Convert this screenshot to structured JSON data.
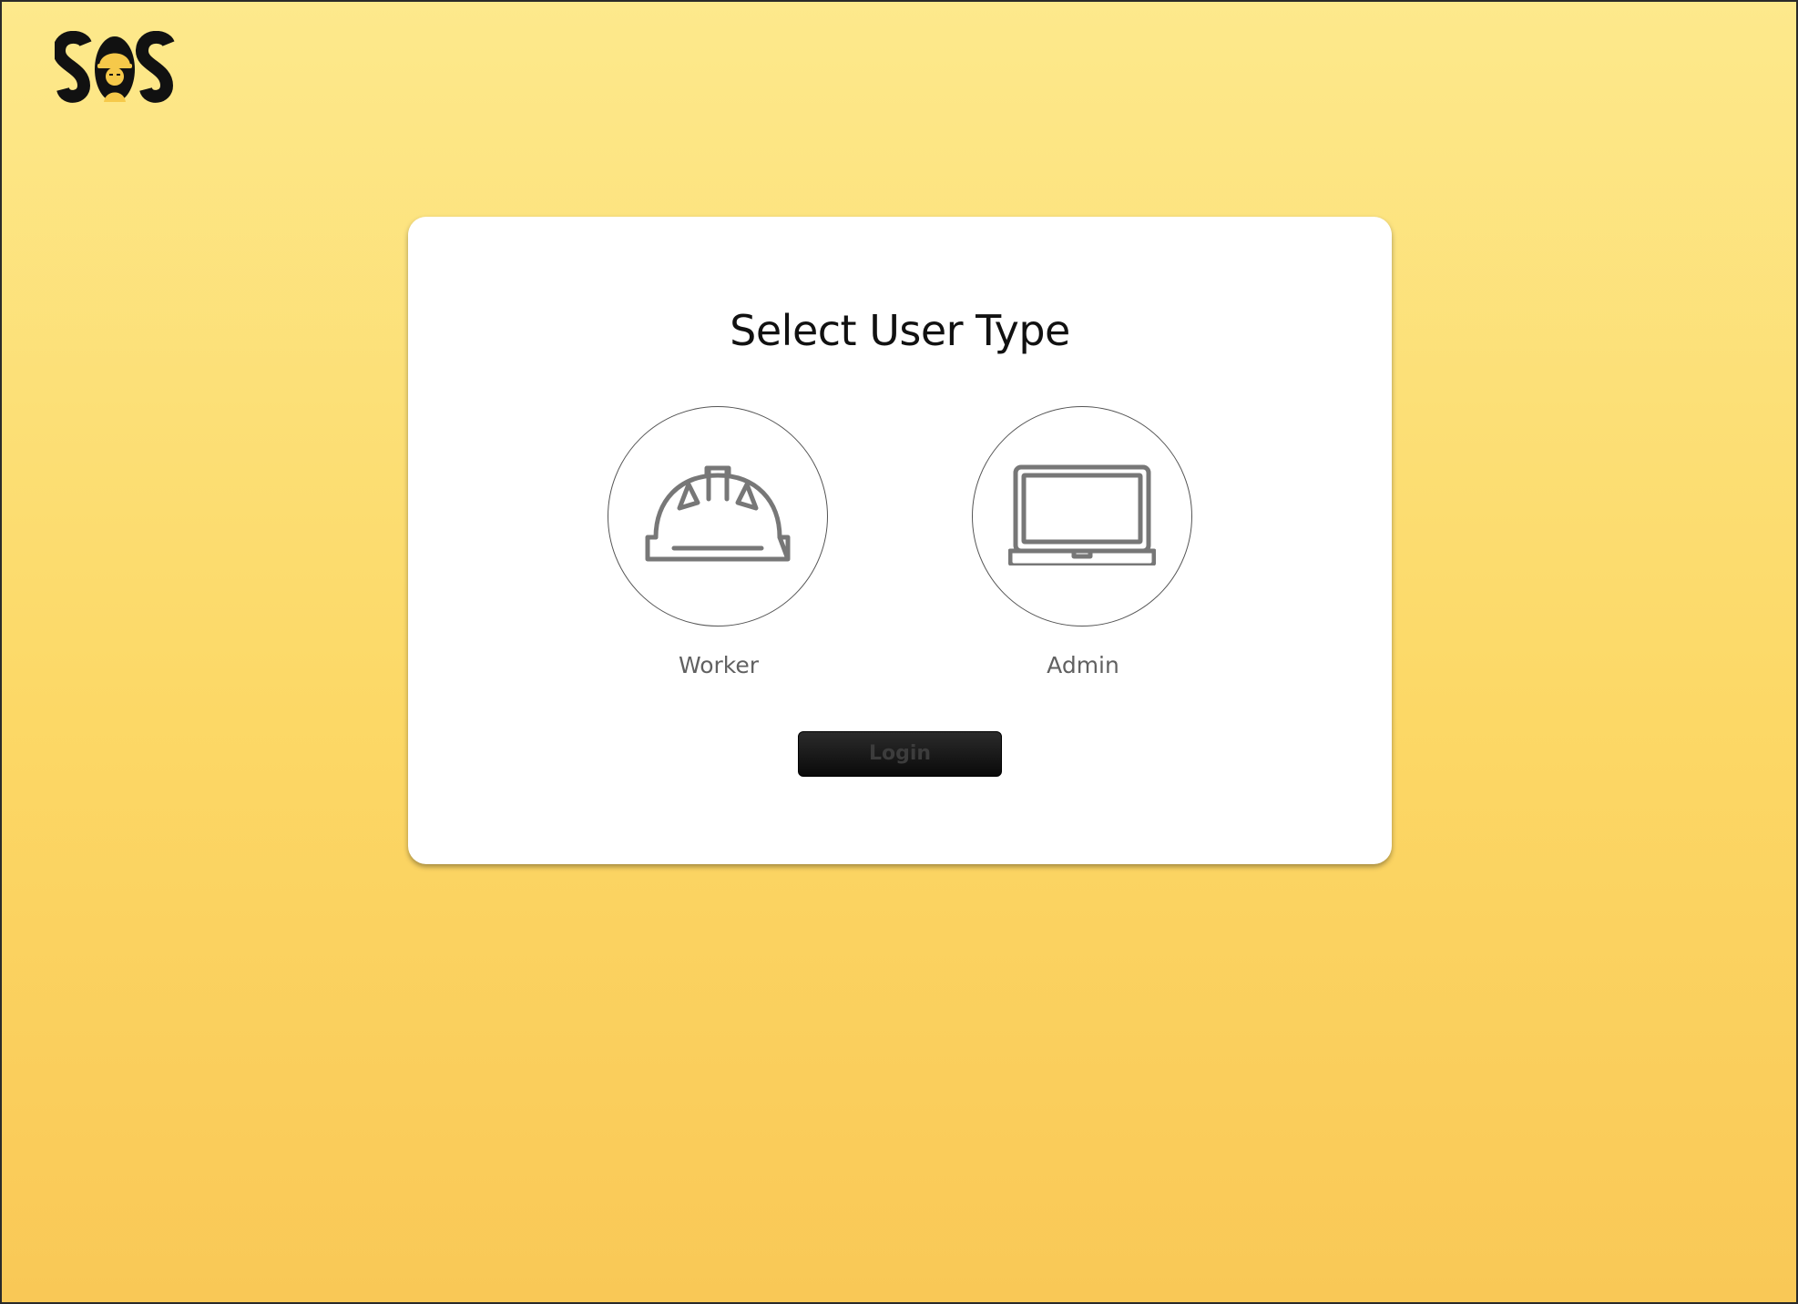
{
  "app": {
    "logo_text": "SOS"
  },
  "card": {
    "title": "Select User Type",
    "options": [
      {
        "label": "Worker",
        "icon": "hard-hat-icon"
      },
      {
        "label": "Admin",
        "icon": "laptop-icon"
      }
    ],
    "login_label": "Login",
    "login_disabled": true
  },
  "colors": {
    "background_top": "#fde98c",
    "background_bottom": "#f9c856",
    "button": "#111111",
    "icon_stroke": "#777777"
  }
}
